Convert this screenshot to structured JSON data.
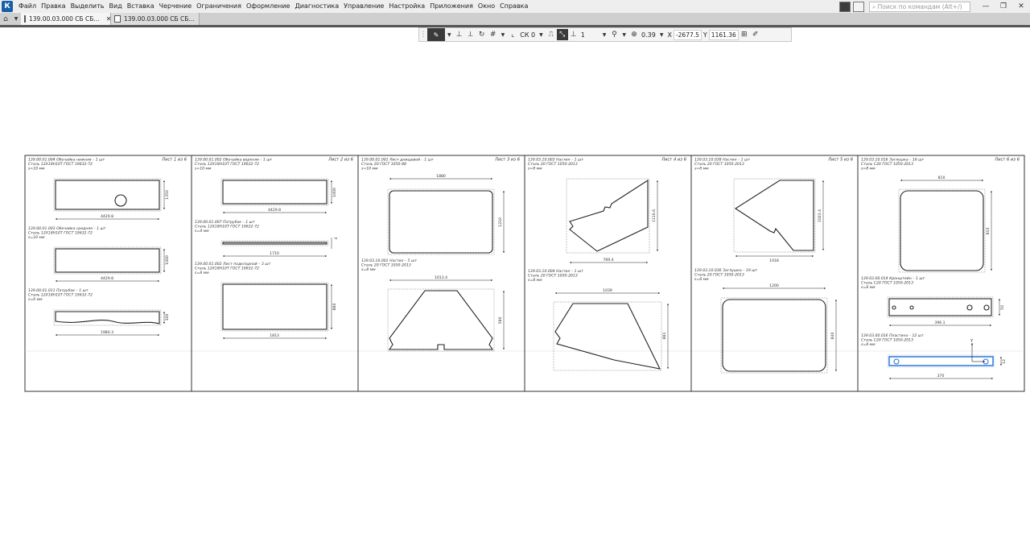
{
  "app": {
    "icon_letter": "К",
    "icon": "kompas-app-icon"
  },
  "menu": {
    "items": [
      "Файл",
      "Правка",
      "Выделить",
      "Вид",
      "Вставка",
      "Черчение",
      "Ограничения",
      "Оформление",
      "Диагностика",
      "Управление",
      "Настройка",
      "Приложения",
      "Окно",
      "Справка"
    ],
    "search_placeholder": "Поиск по командам (Alt+/)",
    "window_controls": [
      "—",
      "❐",
      "✕"
    ]
  },
  "tabs": [
    {
      "label": "139.00.03.000 СБ СБ...",
      "active": true,
      "close": "✕"
    },
    {
      "label": "139.00.03.000 СБ СБ...",
      "active": false
    }
  ],
  "toolbar": {
    "cs_label": "СК 0",
    "style_value": "1",
    "zoom_value": "0.39",
    "x_label": "X",
    "x_value": "-2677.5",
    "y_label": "Y",
    "y_value": "1161.36"
  },
  "sheets": [
    {
      "id": "1",
      "sheet_label": "Лист 1 из 6"
    },
    {
      "id": "2",
      "sheet_label": "Лист 2 из 6"
    },
    {
      "id": "3",
      "sheet_label": "Лист 3 из 6"
    },
    {
      "id": "4",
      "sheet_label": "Лист 4 из 6"
    },
    {
      "id": "5",
      "sheet_label": "Лист 5 из 6"
    },
    {
      "id": "6",
      "sheet_label": "Лист 6 из 6"
    }
  ],
  "parts": [
    {
      "title": "139.00.01.004 Обечайка нижняя – 1 шт",
      "material": "Сталь 12Х18Н10Т ГОСТ 19632-72",
      "thickness": "s=10 мм",
      "dim_w": "4429.8",
      "dim_h": "1350"
    },
    {
      "title": "139.00.01.003 Обечайка средняя – 1 шт",
      "material": "Сталь 12Х18Н10Т ГОСТ 19632-72",
      "thickness": "s=10 мм",
      "dim_w": "4429.8",
      "dim_h": "1000"
    },
    {
      "title": "139.00.01.011 Патрубок – 1 шт",
      "material": "Сталь 12Х18Н10Т ГОСТ 19632-72",
      "thickness": "s=6 мм",
      "dim_w": "1980.3",
      "dim_h": "300"
    },
    {
      "title": "139.00.01.002 Обечайка верхняя – 1 шт",
      "material": "Сталь 12Х18Н10Т ГОСТ 19632-72",
      "thickness": "s=10 мм",
      "dim_w": "4429.8",
      "dim_h": "1000"
    },
    {
      "title": "139.00.01.007 Патрубок – 1 шт",
      "material": "Сталь 12Х18Н10Т ГОСТ 19632-72",
      "thickness": "s=4 мм",
      "dim_w": "1710",
      "dim_h": "4"
    },
    {
      "title": "139.00.01.002 Лист подкладной – 3 шт",
      "material": "Сталь 12Х18Н10Т ГОСТ 19632-72",
      "thickness": "s=8 мм",
      "dim_w": "1813",
      "dim_h": "880"
    },
    {
      "title": "139.00.01.001 Лист днищевой – 1 шт",
      "material": "Сталь 20 ГОСТ 1050-88",
      "thickness": "s=10 мм",
      "dim_w": "1880",
      "dim_h": "1210"
    },
    {
      "title": "139.03.10.001 Настил – 5 шт",
      "material": "Сталь 20 ГОСТ 1050-2013",
      "thickness": "s=8 мм",
      "dim_w": "1013.4",
      "dim_h": "580"
    },
    {
      "title": "139.03.10.003 Настил – 1 шт",
      "material": "Сталь 20 ГОСТ 1050-2013",
      "thickness": "s=8 мм",
      "dim_w": "769.4",
      "dim_h": "1116.6"
    },
    {
      "title": "139.03.10.004 Настил – 1 шт",
      "material": "Сталь 20 ГОСТ 1050-2013",
      "thickness": "s=8 мм",
      "dim_w": "1039",
      "dim_h": "881"
    },
    {
      "title": "139.03.10.038 Настил – 1 шт",
      "material": "Сталь 20 ГОСТ 1050-2013",
      "thickness": "s=8 мм",
      "dim_w": "1018",
      "dim_h": "1022.4"
    },
    {
      "title": "139.03.10.036 Заглушка – 19 шт",
      "material": "Сталь 20 ГОСТ 1050-2013",
      "thickness": "s=8 мм",
      "dim_w": "1200",
      "dim_h": "840"
    },
    {
      "title": "139.03.10.016 Заглушка – 16 шт",
      "material": "Сталь С20 ГОСТ 1050-2013",
      "thickness": "s=8 мм",
      "dim_w": "810",
      "dim_h": "810"
    },
    {
      "title": "139.03.00.014 Кронштейн – 1 шт",
      "material": "Сталь С20 ГОСТ 1050-2013",
      "thickness": "s=8 мм",
      "dim_w": "396.1",
      "dim_h": "50"
    },
    {
      "title": "139.03.00.016 Пластина – 12 шт",
      "material": "Сталь С20 ГОСТ 1050-2013",
      "thickness": "s=8 мм",
      "dim_w": "370",
      "dim_h": "12"
    }
  ],
  "axis": {
    "y_label": "Y"
  }
}
